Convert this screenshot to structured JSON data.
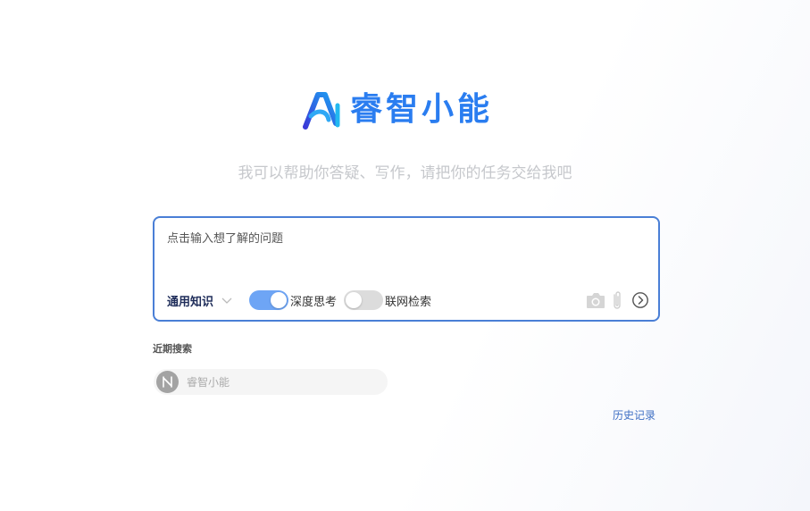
{
  "brand": {
    "name": "睿智小能",
    "logo_icon": "ai-logo-icon",
    "accent": "#2a7df0"
  },
  "subtitle": "我可以帮助你答疑、写作，请把你的任务交给我吧",
  "input": {
    "placeholder": "点击输入想了解的问题",
    "value": "",
    "border_color": "#4a7fd6"
  },
  "toolbar": {
    "knowledge_select": {
      "label": "通用知识",
      "icon": "chevron-down-icon"
    },
    "deep_thinking": {
      "label": "深度思考",
      "on": true
    },
    "web_search": {
      "label": "联网检索",
      "on": false
    },
    "tools": [
      "camera-icon",
      "paperclip-icon",
      "send-arrow-icon"
    ]
  },
  "recent": {
    "title": "近期搜索",
    "items": [
      {
        "label": "睿智小能",
        "avatar_icon": "n-logo-icon"
      }
    ]
  },
  "history_link": "历史记录"
}
